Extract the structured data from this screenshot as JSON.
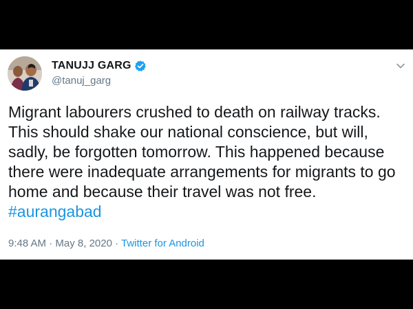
{
  "tweet": {
    "display_name": "TANUJJ GARG",
    "handle": "@tanuj_garg",
    "text": "Migrant labourers crushed to death on railway tracks.\nThis should shake our national conscience, but will,\nsadly, be forgotten tomorrow. This happened because\nthere were inadequate arrangements for migrants to go\nhome and because their travel was not free.",
    "hashtag": "#aurangabad",
    "time": "9:48 AM",
    "separator": " · ",
    "date": "May 8, 2020",
    "source": "Twitter for Android",
    "verified_icon": "verified-badge-icon",
    "menu_icon": "chevron-down-icon"
  },
  "colors": {
    "background": "#000000",
    "card": "#ffffff",
    "text": "#14171a",
    "muted": "#657786",
    "link": "#1b95e0",
    "verified": "#1da1f2"
  }
}
